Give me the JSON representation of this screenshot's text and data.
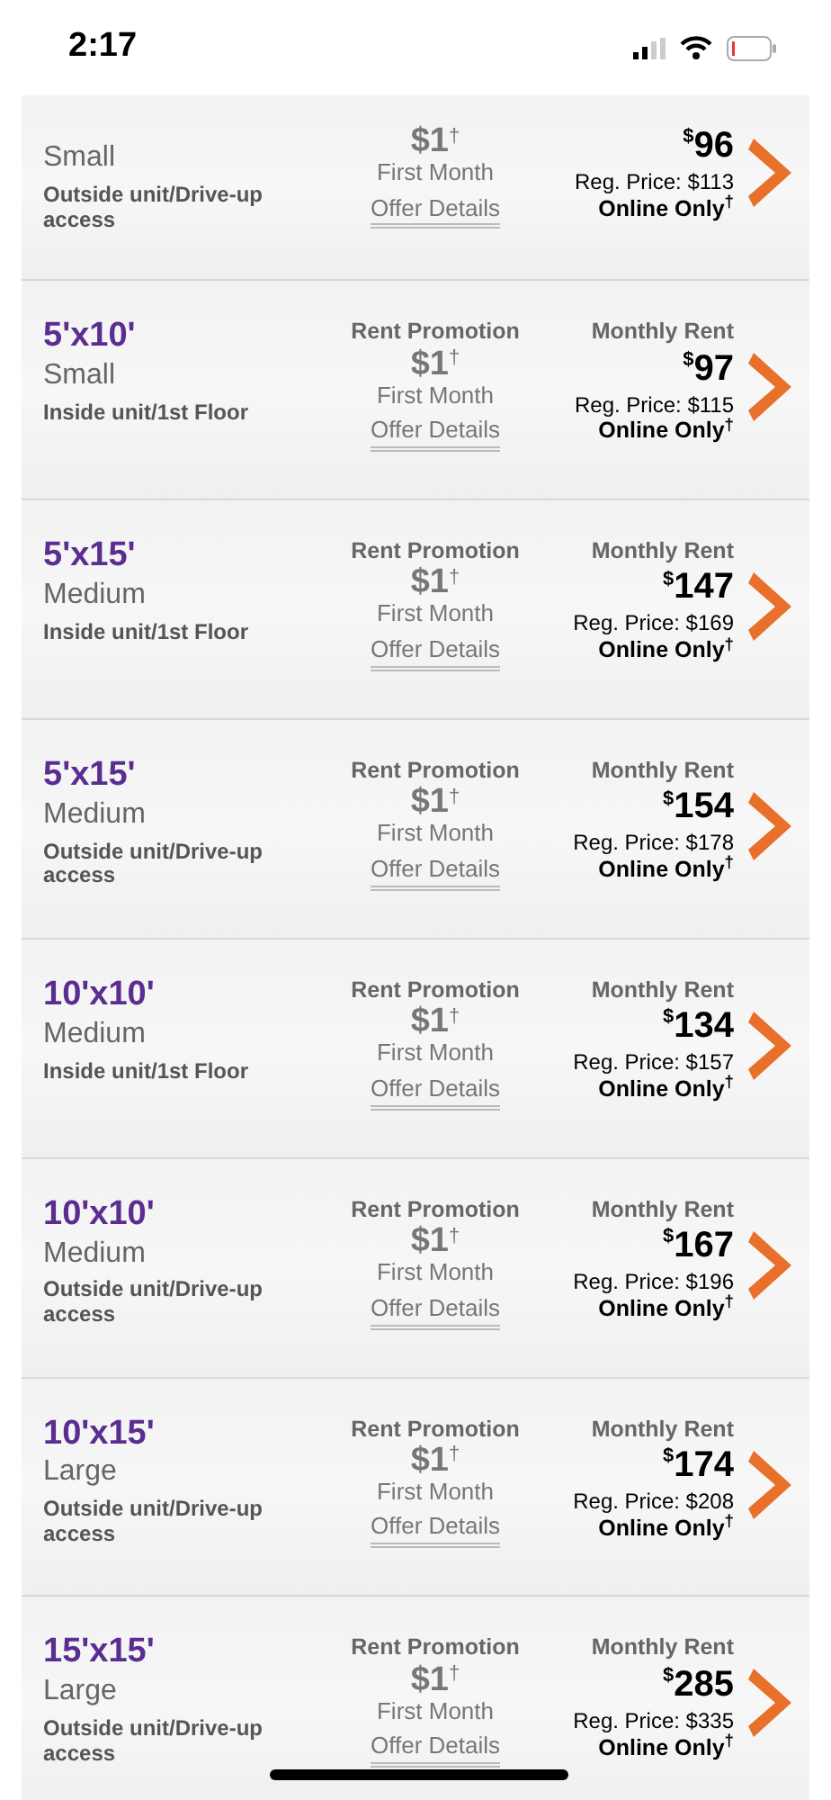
{
  "status_bar": {
    "time": "2:17"
  },
  "units": [
    {
      "category": "Small",
      "access": "Outside unit/Drive-up access",
      "promo_amount": "$1",
      "promo_mark": "†",
      "promo_period": "First Month",
      "offer_link": "Offer Details",
      "currency": "$",
      "price": "96",
      "reg_price": "Reg. Price: $113",
      "online": "Online Only$^{†}$"
    },
    {
      "size": "5'x10'",
      "category": "Small",
      "access": "Inside unit/1st Floor",
      "promo_label": "Rent Promotion",
      "promo_amount": "$1",
      "promo_mark": "†",
      "promo_period": "First Month",
      "offer_link": "Offer Details",
      "rent_label": "Monthly Rent",
      "currency": "$",
      "price": "97",
      "reg_price": "Reg. Price: $115",
      "online": "Online Only$^{†}$"
    },
    {
      "size": "5'x15'",
      "category": "Medium",
      "access": "Inside unit/1st Floor",
      "promo_label": "Rent Promotion",
      "promo_amount": "$1",
      "promo_mark": "†",
      "promo_period": "First Month",
      "offer_link": "Offer Details",
      "rent_label": "Monthly Rent",
      "currency": "$",
      "price": "147",
      "reg_price": "Reg. Price: $169",
      "online": "Online Only$^{†}$"
    },
    {
      "size": "5'x15'",
      "category": "Medium",
      "access": "Outside unit/Drive-up access",
      "promo_label": "Rent Promotion",
      "promo_amount": "$1",
      "promo_mark": "†",
      "promo_period": "First Month",
      "offer_link": "Offer Details",
      "rent_label": "Monthly Rent",
      "currency": "$",
      "price": "154",
      "reg_price": "Reg. Price: $178",
      "online": "Online Only$^{†}$"
    },
    {
      "size": "10'x10'",
      "category": "Medium",
      "access": "Inside unit/1st Floor",
      "promo_label": "Rent Promotion",
      "promo_amount": "$1",
      "promo_mark": "†",
      "promo_period": "First Month",
      "offer_link": "Offer Details",
      "rent_label": "Monthly Rent",
      "currency": "$",
      "price": "134",
      "reg_price": "Reg. Price: $157",
      "online": "Online Only$^{†}$"
    },
    {
      "size": "10'x10'",
      "category": "Medium",
      "access": "Outside unit/Drive-up access",
      "promo_label": "Rent Promotion",
      "promo_amount": "$1",
      "promo_mark": "†",
      "promo_period": "First Month",
      "offer_link": "Offer Details",
      "rent_label": "Monthly Rent",
      "currency": "$",
      "price": "167",
      "reg_price": "Reg. Price: $196",
      "online": "Online Only$^{†}$"
    },
    {
      "size": "10'x15'",
      "category": "Large",
      "access": "Outside unit/Drive-up access",
      "promo_label": "Rent Promotion",
      "promo_amount": "$1",
      "promo_mark": "†",
      "promo_period": "First Month",
      "offer_link": "Offer Details",
      "rent_label": "Monthly Rent",
      "currency": "$",
      "price": "174",
      "reg_price": "Reg. Price: $208",
      "online": "Online Only$^{†}$"
    },
    {
      "size": "15'x15'",
      "category": "Large",
      "access": "Outside unit/Drive-up access",
      "promo_label": "Rent Promotion",
      "promo_amount": "$1",
      "promo_mark": "†",
      "promo_period": "First Month",
      "offer_link": "Offer Details",
      "rent_label": "Monthly Rent",
      "currency": "$",
      "price": "285",
      "reg_price": "Reg. Price: $335",
      "online": "Online Only$^{†}$"
    }
  ]
}
